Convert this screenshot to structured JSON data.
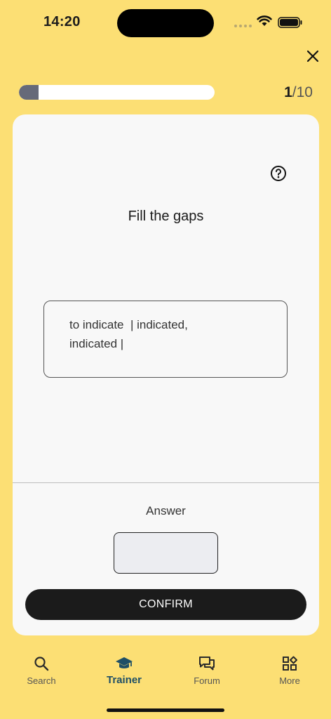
{
  "status": {
    "time": "14:20"
  },
  "progress": {
    "current": "1",
    "total": "/10",
    "fraction": 0.1
  },
  "card": {
    "title": "Fill the gaps",
    "sentence_line1": "to indicate  | indicated,",
    "sentence_line2": "indicated |",
    "answer_label": "Answer",
    "answer_value": "",
    "confirm_label": "CONFIRM"
  },
  "tabs": [
    {
      "label": "Search",
      "icon": "search-icon"
    },
    {
      "label": "Trainer",
      "icon": "graduation-cap-icon",
      "active": true
    },
    {
      "label": "Forum",
      "icon": "chat-bubbles-icon"
    },
    {
      "label": "More",
      "icon": "grid-icon"
    }
  ],
  "colors": {
    "background": "#FCDF74",
    "accent": "#1f4f66",
    "progress_fill": "#666a79",
    "button": "#1b1b1b"
  }
}
